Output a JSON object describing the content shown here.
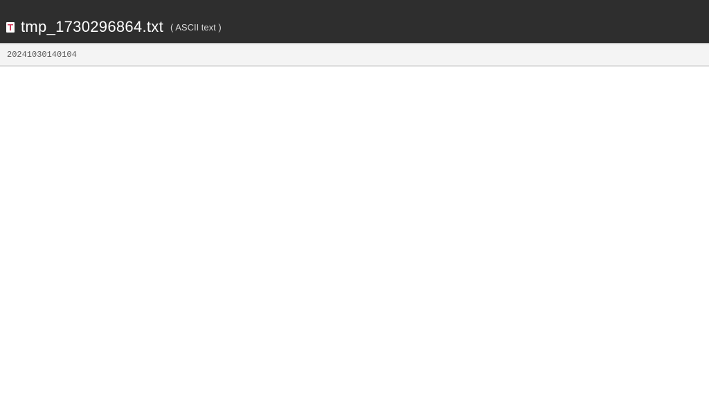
{
  "header": {
    "filename": "tmp_1730296864.txt",
    "filetype": "( ASCII text )"
  },
  "content": {
    "line1": "20241030140104"
  }
}
